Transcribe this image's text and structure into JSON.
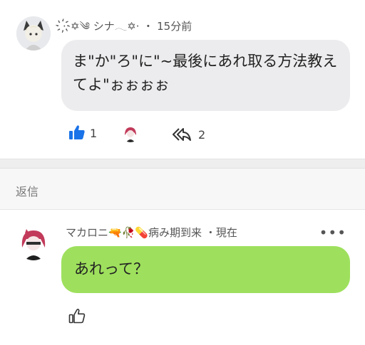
{
  "comment1": {
    "author": "·҉✡︎‎༄ シナ𓂃✡︎·",
    "time": "・ 15分前",
    "text": "ま\"か\"ろ\"に\"~最後にあれ取る方法教えてよ\"ぉぉぉぉ",
    "like_count": "1",
    "reply_count": "2",
    "avatar_icon": "avatar-icon",
    "reacted_user_icon": "avatar-icon",
    "colors": {
      "bubble": "#ececee",
      "like": "#1a73e8"
    }
  },
  "reply_section": {
    "label": "返信"
  },
  "comment2": {
    "author": "マカロニ🔫🥀💊病み期到来",
    "time": "・現在",
    "text": "あれって？",
    "more_label": "•••",
    "colors": {
      "bubble": "#9ee05d"
    }
  }
}
